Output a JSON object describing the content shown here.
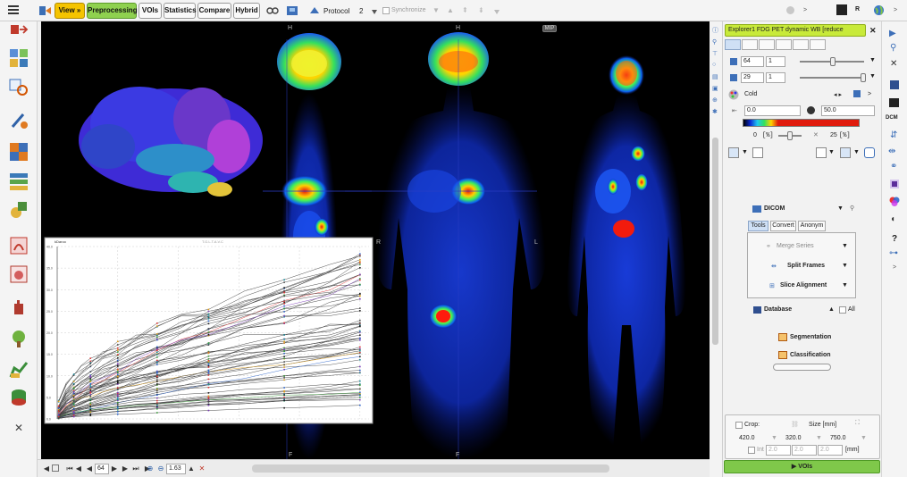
{
  "toolbar": {
    "view_label": "View »",
    "preprocessing_label": "Preprocessing",
    "vois_label": "VOIs",
    "statistics_label": "Statistics",
    "compare_label": "Compare",
    "hybrid_label": "Hybrid",
    "protocol_label": "Protocol",
    "layout_count": "2",
    "synchronize_label": "Synchronize",
    "right_r_label": "R"
  },
  "viewer": {
    "mip_label": "MIP",
    "orient": {
      "h1": "H",
      "h2": "H",
      "r1": "R",
      "l1": "R",
      "r2": "L",
      "f1": "F",
      "f2": "F"
    },
    "chart_header": "kDaroo",
    "chart_title": "T.G.L.T.A.V.C"
  },
  "chart_data": {
    "type": "line",
    "title": "T.G.L.T.A.V.C",
    "ylabel": "",
    "xlabel": "",
    "y_ticks": [
      "40.0",
      "35.0",
      "30.0",
      "25.0",
      "20.0",
      "15.0",
      "10.0",
      "5.0",
      "0.0"
    ],
    "x": [
      0.05,
      0.3,
      0.55,
      0.8,
      1.1,
      1.5,
      2.0,
      2.6,
      3.3,
      4.1,
      5.0,
      6.2,
      7.5,
      9.0,
      10.0
    ],
    "xlim": [
      0,
      10.3
    ],
    "ylim": [
      0,
      40
    ],
    "series_count": 60
  },
  "bottombar": {
    "frame_value": "64",
    "zoom_value": "1.63"
  },
  "panel": {
    "study_title": "Explorer1 FDG PET dynamic WB [reduce",
    "slice1": "64",
    "slice1_step": "1",
    "slice2": "29",
    "slice2_step": "1",
    "colormap": "Cold",
    "lower": "0.0",
    "upper": "50.0",
    "lower_pct": "0",
    "pct_unit": "[%]",
    "upper_pct": "25",
    "pct_unit2": "[%]",
    "dicom_label": "DICOM",
    "tabs": [
      "Tools",
      "Convert",
      "Anonym"
    ],
    "merge_series": "Merge Series",
    "split_frames": "Split Frames",
    "slice_alignment": "Slice Alignment",
    "database_label": "Database",
    "all_label": "All",
    "segmentation_label": "Segmentation",
    "classification_label": "Classification",
    "crop_label": "Crop:",
    "size_label": "Size [mm]",
    "crop_x": "420.0",
    "crop_y": "320.0",
    "crop_z": "750.0",
    "int_label": "Int",
    "int_a": "2.0",
    "int_b": "2.0",
    "int_c": "2.0",
    "mm_label": "[mm]",
    "vois_button": "VOIs"
  },
  "rightbar": {
    "dcm_label": "DCM",
    "help_label": "?"
  },
  "colors": {
    "view_button": "#f5c400",
    "preprocessing_button": "#8fd14f",
    "study_banner": "#c8ea3a",
    "vois_bottom": "#7fc84a"
  }
}
